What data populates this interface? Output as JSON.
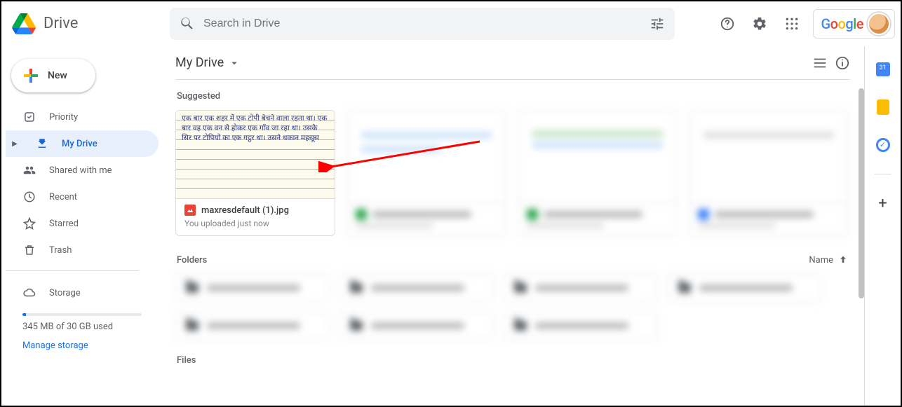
{
  "header": {
    "app_name": "Drive",
    "search_placeholder": "Search in Drive",
    "account_label": "Google"
  },
  "sidebar": {
    "new_label": "New",
    "items": [
      {
        "label": "Priority"
      },
      {
        "label": "My Drive"
      },
      {
        "label": "Shared with me"
      },
      {
        "label": "Recent"
      },
      {
        "label": "Starred"
      },
      {
        "label": "Trash"
      }
    ],
    "storage_label": "Storage",
    "storage_used": "345 MB of 30 GB used",
    "manage_label": "Manage storage"
  },
  "breadcrumb": {
    "path": "My Drive"
  },
  "sections": {
    "suggested": "Suggested",
    "folders": "Folders",
    "files": "Files",
    "name_sort": "Name"
  },
  "suggested_card": {
    "filename": "maxresdefault (1).jpg",
    "subtitle": "You uploaded just now",
    "thumb_text": "एक बार एक शहर में एक टोपी बेचने वाला रहता था। एक बार वह एक वन से होकर एक गाँव जा रहा था। उसके सिर पर टोपियों का एक गट्ठर था। उसने थकान महसूस"
  }
}
